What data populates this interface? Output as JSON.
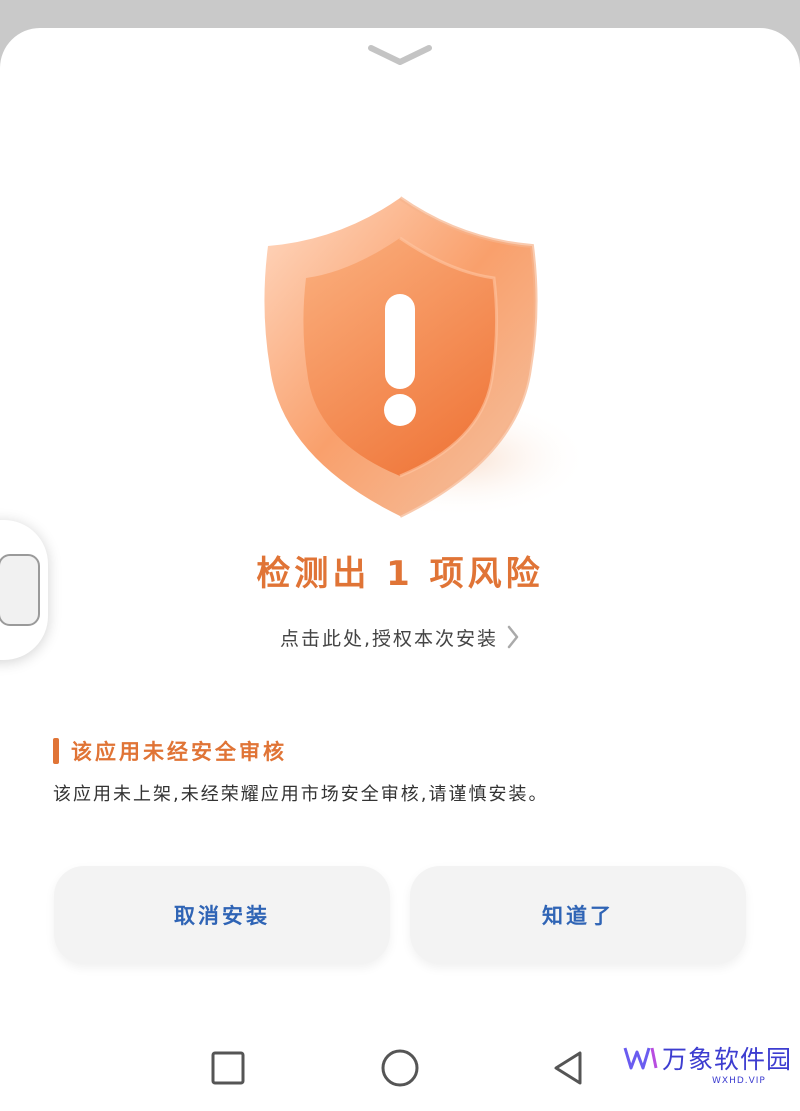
{
  "risk_title": "检测出 1 项风险",
  "authorize_link": "点击此处,授权本次安装",
  "section": {
    "title": "该应用未经安全审核",
    "description": "该应用未上架,未经荣耀应用市场安全审核,请谨慎安装。"
  },
  "buttons": {
    "cancel": "取消安装",
    "ok": "知道了"
  },
  "watermark": {
    "name": "万象软件园",
    "url": "WXHD.VIP"
  },
  "icons": {
    "handle": "chevron-down-icon",
    "shield": "shield-warning-icon",
    "link_arrow": "chevron-right-icon",
    "recent": "square-icon",
    "home": "circle-icon",
    "back": "triangle-back-icon"
  },
  "colors": {
    "accent": "#e07436",
    "button_text": "#2f64b5",
    "watermark": "#3d3dd0"
  }
}
